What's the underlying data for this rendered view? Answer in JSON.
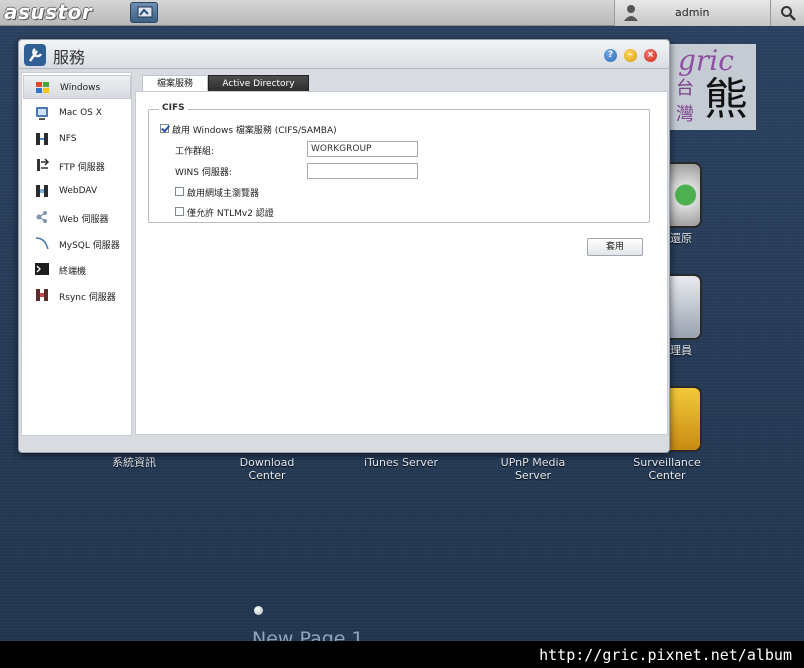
{
  "topbar": {
    "logo_text": "asustor",
    "username": "admin"
  },
  "desktop": {
    "labels": [
      {
        "text": "系統資訊"
      },
      {
        "text": "Download\nCenter"
      },
      {
        "text": "iTunes Server"
      },
      {
        "text": "UPnP Media\nServer"
      },
      {
        "text": "Surveillance\nCenter"
      },
      {
        "text": "還原"
      },
      {
        "text": "理員"
      }
    ],
    "page_label": "New Page 1"
  },
  "watermark": {
    "gric": "gric",
    "tai": "台",
    "wan": "灣",
    "xiong": "熊"
  },
  "window": {
    "title": "服務",
    "sidebar": [
      {
        "label": "Windows",
        "icon": "windows-icon"
      },
      {
        "label": "Mac OS X",
        "icon": "mac-icon"
      },
      {
        "label": "NFS",
        "icon": "nfs-icon"
      },
      {
        "label": "FTP 伺服器",
        "icon": "ftp-icon"
      },
      {
        "label": "WebDAV",
        "icon": "webdav-icon"
      },
      {
        "label": "Web 伺服器",
        "icon": "web-server-icon"
      },
      {
        "label": "MySQL 伺服器",
        "icon": "mysql-icon"
      },
      {
        "label": "終端機",
        "icon": "terminal-icon"
      },
      {
        "label": "Rsync 伺服器",
        "icon": "rsync-icon"
      }
    ],
    "tabs": [
      {
        "label": "檔案服務"
      },
      {
        "label": "Active Directory"
      }
    ],
    "cifs": {
      "legend": "CIFS",
      "enable_label": "啟用 Windows 檔案服務 (CIFS/SAMBA)",
      "enable_checked": true,
      "workgroup_label": "工作群組:",
      "workgroup_value": "WORKGROUP",
      "wins_label": "WINS 伺服器:",
      "wins_value": "",
      "master_browser_label": "啟用網域主瀏覽器",
      "master_browser_checked": false,
      "ntlm_label": "僅允許 NTLMv2 認證",
      "ntlm_checked": false
    },
    "apply_label": "套用"
  },
  "footer": {
    "url": "http://gric.pixnet.net/album"
  }
}
